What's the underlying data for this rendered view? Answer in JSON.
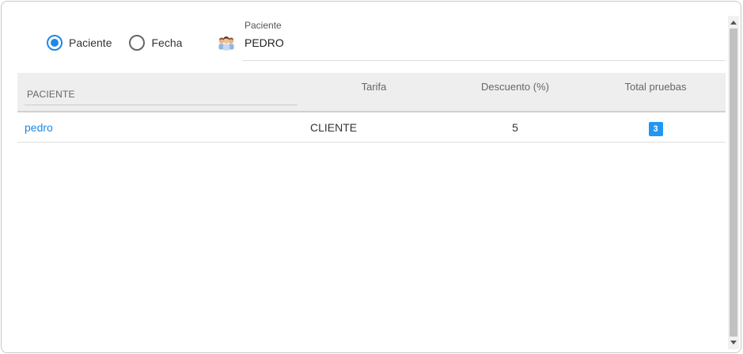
{
  "filters": {
    "options": [
      {
        "label": "Paciente",
        "checked": true
      },
      {
        "label": "Fecha",
        "checked": false
      }
    ]
  },
  "patient_field": {
    "label": "Paciente",
    "value": "PEDRO",
    "icon": "patients-group-icon"
  },
  "table": {
    "columns": [
      "PACIENTE",
      "Tarifa",
      "Descuento (%)",
      "Total pruebas"
    ],
    "rows": [
      {
        "paciente": "pedro",
        "tarifa": "CLIENTE",
        "descuento": "5",
        "total": "3"
      }
    ]
  },
  "colors": {
    "accent": "#1e88e5",
    "badge": "#2196f3",
    "header_bg": "#eeeeee"
  }
}
